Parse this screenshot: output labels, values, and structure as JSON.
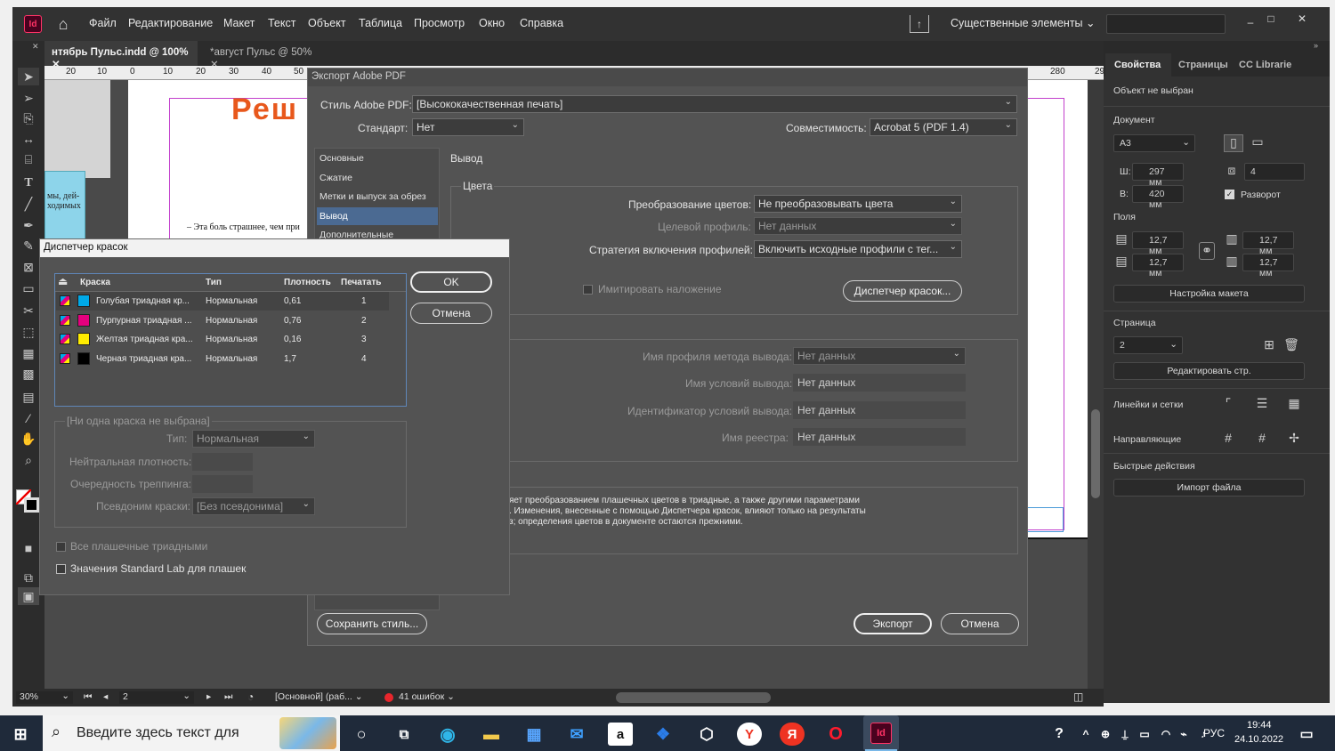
{
  "menubar": {
    "app_icon": "Id",
    "items": [
      "Файл",
      "Редактирование",
      "Макет",
      "Текст",
      "Объект",
      "Таблица",
      "Просмотр",
      "Окно",
      "Справка"
    ],
    "workspace": "Существенные элементы"
  },
  "doc_tabs": [
    {
      "label": "нтябрь Пульс.indd @ 100%",
      "active": true
    },
    {
      "label": "*август Пульс @ 50%",
      "active": false
    }
  ],
  "ruler": {
    "ticks": [
      "20",
      "10",
      "0",
      "10",
      "20",
      "30",
      "40",
      "50",
      "280",
      "29"
    ]
  },
  "canvas": {
    "heading_fragment": "Реш",
    "text_fragment_1": "мы, дей-",
    "text_fragment_2": "ходимых",
    "body_fragment": "– Эта боль страшнее, чем при"
  },
  "export_dialog": {
    "title": "Экспорт Adobe PDF",
    "style_label": "Стиль Adobe PDF:",
    "style_value": "[Высококачественная печать]",
    "standard_label": "Стандарт:",
    "standard_value": "Нет",
    "compat_label": "Совместимость:",
    "compat_value": "Acrobat 5 (PDF 1.4)",
    "nav": [
      "Основные",
      "Сжатие",
      "Метки и выпуск за обрез",
      "Вывод",
      "Дополнительные"
    ],
    "nav_active": 3,
    "section_title": "Вывод",
    "colors_group": "Цвета",
    "conv_label": "Преобразование цветов:",
    "conv_value": "Не преобразовывать цвета",
    "target_label": "Целевой профиль:",
    "target_value": "Нет данных",
    "policy_label": "Стратегия включения профилей:",
    "policy_value": "Включить исходные профили с тег...",
    "simulate_label": "Имитировать наложение",
    "ink_mgr_button": "Диспетчер красок...",
    "output_profile_label": "Имя профиля метода вывода:",
    "output_profile_value": "Нет данных",
    "cond_name_label": "Имя условий вывода:",
    "cond_name_value": "Нет данных",
    "cond_id_label": "Идентификатор условий вывода:",
    "cond_id_value": "Нет данных",
    "registry_label": "Имя реестра:",
    "registry_value": "Нет данных",
    "description_lines": [
      "яет преобразованием плашечных цветов в триадные, а также другими параметрами",
      ". Изменения, внесенные с помощью Диспетчера красок, влияют только на результаты",
      "з; определения цветов в документе остаются прежними."
    ],
    "save_style_button": "Сохранить стиль...",
    "export_button": "Экспорт",
    "cancel_button": "Отмена"
  },
  "ink_manager": {
    "title": "Диспетчер красок",
    "columns": [
      "Краска",
      "Тип",
      "Плотность",
      "Печатать"
    ],
    "rows": [
      {
        "name": "Голубая триадная кр...",
        "type": "Нормальная",
        "density": "0,61",
        "seq": "1",
        "color": "#00a9e8"
      },
      {
        "name": "Пурпурная триадная ...",
        "type": "Нормальная",
        "density": "0,76",
        "seq": "2",
        "color": "#e5007e"
      },
      {
        "name": "Желтая триадная кра...",
        "type": "Нормальная",
        "density": "0,16",
        "seq": "3",
        "color": "#ffec00"
      },
      {
        "name": "Черная триадная кра...",
        "type": "Нормальная",
        "density": "1,7",
        "seq": "4",
        "color": "#000000"
      }
    ],
    "ok_button": "OK",
    "cancel_button": "Отмена",
    "none_selected": "[Ни одна краска не выбрана]",
    "type_label": "Тип:",
    "type_value": "Нормальная",
    "neutral_label": "Нейтральная плотность:",
    "trap_label": "Очередность треппинга:",
    "alias_label": "Псевдоним краски:",
    "alias_value": "[Без псевдонима]",
    "all_spots_label": "Все плашечные триадными",
    "standard_lab_label": "Значения Standard Lab для плашек"
  },
  "right_panel": {
    "tabs": [
      "Свойства",
      "Страницы",
      "CC Librarie"
    ],
    "no_selection": "Объект не выбран",
    "document_label": "Документ",
    "size_value": "A3",
    "w_label": "Ш:",
    "w_value": "297 мм",
    "h_label": "В:",
    "h_value": "420 мм",
    "pages_value": "4",
    "spread_label": "Разворот",
    "margins_label": "Поля",
    "margin_top": "12,7 мм",
    "margin_bottom": "12,7 мм",
    "margin_left": "12,7 мм",
    "margin_right": "12,7 мм",
    "layout_button": "Настройка макета",
    "page_label": "Страница",
    "page_value": "2",
    "edit_page_button": "Редактировать стр.",
    "rulers_label": "Линейки и сетки",
    "guides_label": "Направляющие",
    "quick_label": "Быстрые действия",
    "import_button": "Импорт файла"
  },
  "status": {
    "zoom": "30%",
    "page": "2",
    "master": "[Основной] (раб...",
    "errors": "41 ошибок"
  },
  "taskbar": {
    "search_placeholder": "Введите здесь текст для",
    "lang": "РУС",
    "time": "19:44",
    "date": "24.10.2022"
  }
}
